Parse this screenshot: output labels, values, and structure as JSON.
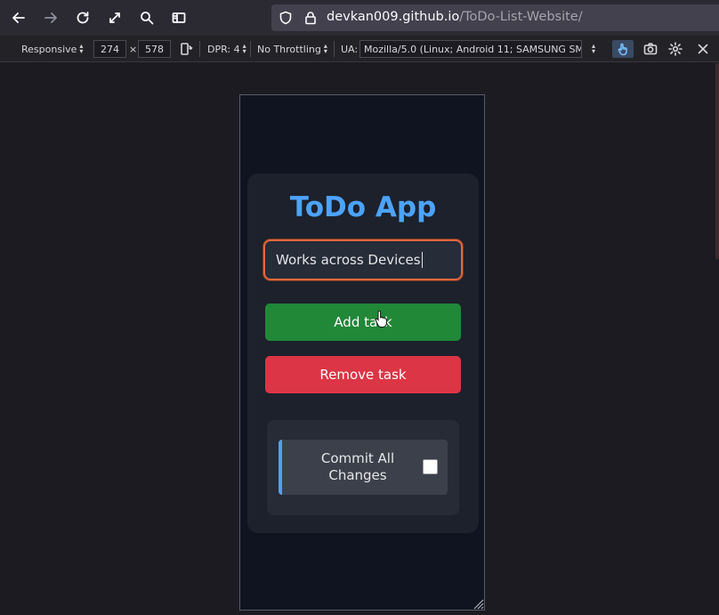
{
  "browser": {
    "url_host": "devkan009.github.io",
    "url_path": "/ToDo-List-Website/"
  },
  "rdm_toolbar": {
    "device": "Responsive",
    "width": "274",
    "times": "×",
    "height": "578",
    "dpr": "DPR: 4",
    "throttling": "No Throttling",
    "ua_label": "UA:",
    "ua_value": "Mozilla/5.0 (Linux; Android 11; SAMSUNG SM-"
  },
  "app": {
    "title": "ToDo App",
    "task_input_value": "Works across Devices",
    "add_label": "Add task",
    "remove_label": "Remove task",
    "commit_label_line1": "Commit All",
    "commit_label_line2": "Changes",
    "commit_checked": false
  },
  "colors": {
    "title": "#4ca3ff",
    "add_button": "#218838",
    "remove_button": "#dc3545",
    "input_focus_border": "#e3673f"
  }
}
